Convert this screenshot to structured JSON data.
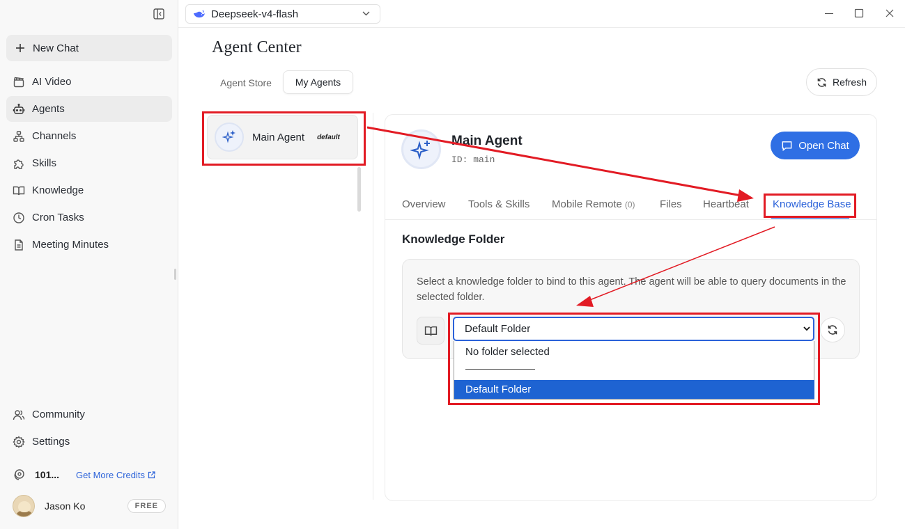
{
  "sidebar": {
    "new_chat": "New Chat",
    "items": [
      {
        "label": "AI Video",
        "icon": "clapperboard-icon"
      },
      {
        "label": "Agents",
        "icon": "robot-icon",
        "active": true
      },
      {
        "label": "Channels",
        "icon": "network-icon"
      },
      {
        "label": "Skills",
        "icon": "puzzle-icon"
      },
      {
        "label": "Knowledge",
        "icon": "book-icon"
      },
      {
        "label": "Cron Tasks",
        "icon": "clock-icon"
      },
      {
        "label": "Meeting Minutes",
        "icon": "document-icon"
      }
    ],
    "bottom_items": [
      {
        "label": "Community",
        "icon": "users-icon"
      },
      {
        "label": "Settings",
        "icon": "gear-icon"
      }
    ],
    "credits": {
      "value": "101...",
      "link": "Get More Credits"
    },
    "user": {
      "name": "Jason Ko",
      "plan": "FREE"
    }
  },
  "topbar": {
    "model": "Deepseek-v4-flash"
  },
  "main": {
    "title": "Agent Center",
    "tabs": {
      "store": "Agent Store",
      "mine": "My Agents"
    },
    "refresh": "Refresh",
    "agent_list": [
      {
        "name": "Main Agent",
        "tag": "default"
      }
    ],
    "detail": {
      "name": "Main Agent",
      "id": "ID: main",
      "open_chat": "Open Chat",
      "tabs": [
        {
          "label": "Overview"
        },
        {
          "label": "Tools & Skills"
        },
        {
          "label": "Mobile Remote",
          "count": "(0)"
        },
        {
          "label": "Files"
        },
        {
          "label": "Heartbeat"
        },
        {
          "label": "Knowledge Base",
          "active": true
        }
      ],
      "section_title": "Knowledge Folder",
      "description": "Select a knowledge folder to bind to this agent. The agent will be able to query documents in the selected folder.",
      "select_value": "Default Folder",
      "options": [
        {
          "label": "No folder selected"
        },
        {
          "label": "Default Folder",
          "selected": true
        }
      ]
    }
  },
  "colors": {
    "accent": "#2b62d9",
    "primary_button": "#2f6fe4",
    "annotation_red": "#e21b24",
    "option_selected": "#1e63d2"
  }
}
